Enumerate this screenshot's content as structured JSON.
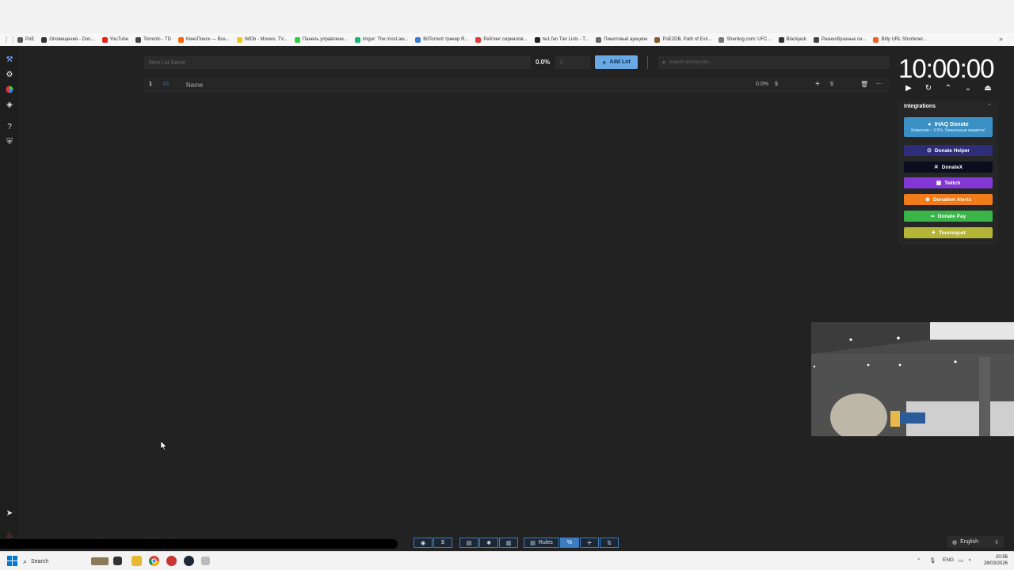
{
  "bookmarks": {
    "items": [
      {
        "label": "PoE",
        "color": "#555555"
      },
      {
        "label": "Оповещения - Don...",
        "color": "#333333"
      },
      {
        "label": "YouTube",
        "color": "#e62117"
      },
      {
        "label": "Torrents - TD",
        "color": "#444444"
      },
      {
        "label": "КиноПоиск — Все...",
        "color": "#ff6600"
      },
      {
        "label": "IMDb - Movies, TV...",
        "color": "#f5c518"
      },
      {
        "label": "Панель управлени...",
        "color": "#2ecc40"
      },
      {
        "label": "Imgur: The most aw...",
        "color": "#1bb76e"
      },
      {
        "label": "BitTorrent трекер R...",
        "color": "#3b7dd8"
      },
      {
        "label": "Рейтинг сериалов...",
        "color": "#e33b3b"
      },
      {
        "label": "№1 fan Tier Lists - T...",
        "color": "#222222"
      },
      {
        "label": "Пинитовый аукцион",
        "color": "#666666"
      },
      {
        "label": "PoE2DB, Path of Exil...",
        "color": "#8a5a2b"
      },
      {
        "label": "Sherdog.com: UFC...",
        "color": "#777777"
      },
      {
        "label": "Blackjack",
        "color": "#333333"
      },
      {
        "label": "Разнообразные си...",
        "color": "#444444"
      },
      {
        "label": "Bitly URL Shortener...",
        "color": "#ee6123"
      }
    ]
  },
  "toolbar": {
    "lot_name_placeholder": "New Lot Name",
    "percent": "0.0%",
    "amount_placeholder": "$",
    "add_lot_label": "Add Lot",
    "search_placeholder": "Search among lots..."
  },
  "lots": [
    {
      "index": "1",
      "tag": "#1",
      "name": "Name",
      "percent": "0.0%",
      "currency": "$",
      "currency2": "$"
    }
  ],
  "timer": {
    "value": "10:00:00"
  },
  "integrations": {
    "title": "Integrations",
    "ihaq": {
      "label": "IHAQ Donate",
      "sub": "Комиссия – 3,5%. Уникальные виджеты!",
      "color": "#3a8fc4"
    },
    "items": [
      {
        "label": "Donate Helper",
        "color": "#2d2d7a"
      },
      {
        "label": "DonateX",
        "color": "#0c0c1e"
      },
      {
        "label": "Twitch",
        "color": "#8338d6"
      },
      {
        "label": "Donation Alerts",
        "color": "#f07c1a"
      },
      {
        "label": "Donate Pay",
        "color": "#39b54a"
      },
      {
        "label": "Tourniquet",
        "color": "#b4b436"
      }
    ]
  },
  "bottom_bar": {
    "rules_label": "Rules",
    "language": "English"
  },
  "taskbar": {
    "search_label": "Search",
    "lang": "ENG",
    "time": "20:56",
    "date": "28/03/2026"
  }
}
